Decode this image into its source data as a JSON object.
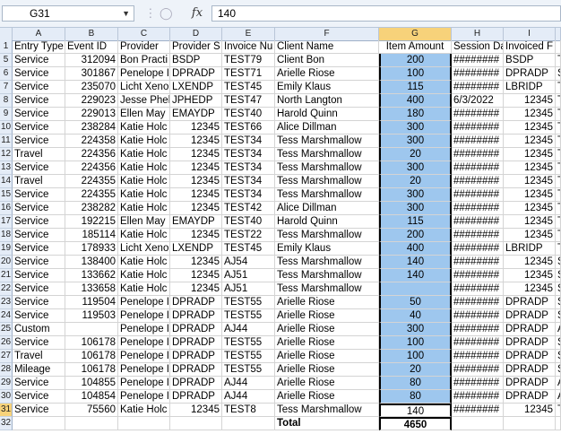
{
  "name_box": "G31",
  "formula": "140",
  "columns": [
    "A",
    "B",
    "C",
    "D",
    "E",
    "F",
    "G",
    "H",
    "I",
    ""
  ],
  "header_row": {
    "num": "1",
    "cells": [
      "Entry Type",
      "Event ID",
      "Provider",
      "Provider S",
      "Invoice Nu",
      "Client Name",
      "Item Amount",
      "Session Da",
      "Invoiced F",
      ""
    ]
  },
  "rows": [
    {
      "num": "5",
      "cells": [
        "Service",
        "312094",
        "Bon Practi",
        "BSDP",
        "TEST79",
        "Client Bon",
        "200",
        "########",
        "BSDP",
        "T"
      ]
    },
    {
      "num": "6",
      "cells": [
        "Service",
        "301867",
        "Penelope I",
        "DPRADP",
        "TEST71",
        "Arielle Riose",
        "100",
        "########",
        "DPRADP",
        "S"
      ]
    },
    {
      "num": "7",
      "cells": [
        "Service",
        "235070",
        "Licht Xeno",
        "LXENDP",
        "TEST45",
        "Emily Klaus",
        "115",
        "########",
        "LBRIDP",
        "T"
      ]
    },
    {
      "num": "8",
      "cells": [
        "Service",
        "229023",
        "Jesse Phel",
        "JPHEDP",
        "TEST47",
        "North Langton",
        "400",
        "6/3/2022",
        "12345",
        "T"
      ]
    },
    {
      "num": "9",
      "cells": [
        "Service",
        "229013",
        "Ellen May",
        "EMAYDP",
        "TEST40",
        "Harold Quinn",
        "180",
        "########",
        "12345",
        "T"
      ]
    },
    {
      "num": "10",
      "cells": [
        "Service",
        "238284",
        "Katie Holc",
        "12345",
        "TEST66",
        "Alice Dillman",
        "300",
        "########",
        "12345",
        "T"
      ]
    },
    {
      "num": "11",
      "cells": [
        "Service",
        "224358",
        "Katie Holc",
        "12345",
        "TEST34",
        "Tess Marshmallow",
        "300",
        "########",
        "12345",
        "T"
      ]
    },
    {
      "num": "12",
      "cells": [
        "Travel",
        "224356",
        "Katie Holc",
        "12345",
        "TEST34",
        "Tess Marshmallow",
        "20",
        "########",
        "12345",
        "T"
      ]
    },
    {
      "num": "13",
      "cells": [
        "Service",
        "224356",
        "Katie Holc",
        "12345",
        "TEST34",
        "Tess Marshmallow",
        "300",
        "########",
        "12345",
        "T"
      ]
    },
    {
      "num": "14",
      "cells": [
        "Travel",
        "224355",
        "Katie Holc",
        "12345",
        "TEST34",
        "Tess Marshmallow",
        "20",
        "########",
        "12345",
        "T"
      ]
    },
    {
      "num": "15",
      "cells": [
        "Service",
        "224355",
        "Katie Holc",
        "12345",
        "TEST34",
        "Tess Marshmallow",
        "300",
        "########",
        "12345",
        "T"
      ]
    },
    {
      "num": "16",
      "cells": [
        "Service",
        "238282",
        "Katie Holc",
        "12345",
        "TEST42",
        "Alice Dillman",
        "300",
        "########",
        "12345",
        "T"
      ]
    },
    {
      "num": "17",
      "cells": [
        "Service",
        "192215",
        "Ellen May",
        "EMAYDP",
        "TEST40",
        "Harold Quinn",
        "115",
        "########",
        "12345",
        "T"
      ]
    },
    {
      "num": "18",
      "cells": [
        "Service",
        "185114",
        "Katie Holc",
        "12345",
        "TEST22",
        "Tess Marshmallow",
        "200",
        "########",
        "12345",
        "T"
      ]
    },
    {
      "num": "19",
      "cells": [
        "Service",
        "178933",
        "Licht Xeno",
        "LXENDP",
        "TEST45",
        "Emily Klaus",
        "400",
        "########",
        "LBRIDP",
        "T"
      ]
    },
    {
      "num": "20",
      "cells": [
        "Service",
        "138400",
        "Katie Holc",
        "12345",
        "AJ54",
        "Tess Marshmallow",
        "140",
        "########",
        "12345",
        "S"
      ]
    },
    {
      "num": "21",
      "cells": [
        "Service",
        "133662",
        "Katie Holc",
        "12345",
        "AJ51",
        "Tess Marshmallow",
        "140",
        "########",
        "12345",
        "S"
      ]
    },
    {
      "num": "22",
      "cells": [
        "Service",
        "133658",
        "Katie Holc",
        "12345",
        "AJ51",
        "Tess Marshmallow",
        "",
        "########",
        "12345",
        "S"
      ]
    },
    {
      "num": "23",
      "cells": [
        "Service",
        "119504",
        "Penelope I",
        "DPRADP",
        "TEST55",
        "Arielle Riose",
        "50",
        "########",
        "DPRADP",
        "S"
      ]
    },
    {
      "num": "24",
      "cells": [
        "Service",
        "119503",
        "Penelope I",
        "DPRADP",
        "TEST55",
        "Arielle Riose",
        "40",
        "########",
        "DPRADP",
        "S"
      ]
    },
    {
      "num": "25",
      "cells": [
        "Custom",
        "",
        "Penelope I",
        "DPRADP",
        "AJ44",
        "Arielle Riose",
        "300",
        "########",
        "DPRADP",
        "A"
      ]
    },
    {
      "num": "26",
      "cells": [
        "Service",
        "106178",
        "Penelope I",
        "DPRADP",
        "TEST55",
        "Arielle Riose",
        "100",
        "########",
        "DPRADP",
        "S"
      ]
    },
    {
      "num": "27",
      "cells": [
        "Travel",
        "106178",
        "Penelope I",
        "DPRADP",
        "TEST55",
        "Arielle Riose",
        "100",
        "########",
        "DPRADP",
        "S"
      ]
    },
    {
      "num": "28",
      "cells": [
        "Mileage",
        "106178",
        "Penelope I",
        "DPRADP",
        "TEST55",
        "Arielle Riose",
        "20",
        "########",
        "DPRADP",
        "S"
      ]
    },
    {
      "num": "29",
      "cells": [
        "Service",
        "104855",
        "Penelope I",
        "DPRADP",
        "AJ44",
        "Arielle Riose",
        "80",
        "########",
        "DPRADP",
        "A"
      ]
    },
    {
      "num": "30",
      "cells": [
        "Service",
        "104854",
        "Penelope I",
        "DPRADP",
        "AJ44",
        "Arielle Riose",
        "80",
        "########",
        "DPRADP",
        "A"
      ]
    },
    {
      "num": "31",
      "cells": [
        "Service",
        "75560",
        "Katie Holc",
        "12345",
        "TEST8",
        "Tess Marshmallow",
        "140",
        "########",
        "12345",
        "T"
      ]
    }
  ],
  "total_row": {
    "num": "32",
    "cells": [
      "",
      "",
      "",
      "",
      "",
      "Total",
      "4650",
      "",
      "",
      ""
    ]
  }
}
